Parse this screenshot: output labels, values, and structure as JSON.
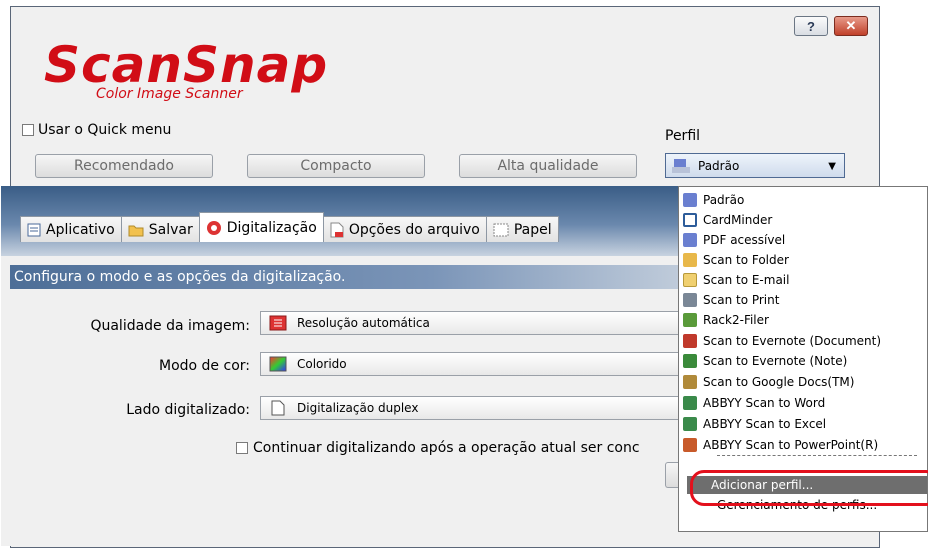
{
  "window": {
    "help_glyph": "?",
    "close_glyph": "✕"
  },
  "logo": {
    "brand": "ScanSnap",
    "tagline": "Color Image Scanner"
  },
  "quick_menu": {
    "label": "Usar o Quick menu",
    "checked": false
  },
  "profile": {
    "label": "Perfil",
    "selected": "Padrão"
  },
  "preset_buttons": [
    "Recomendado",
    "Compacto",
    "Alta qualidade"
  ],
  "tabs": [
    {
      "label": "Aplicativo",
      "icon": "application-icon"
    },
    {
      "label": "Salvar",
      "icon": "folder-icon"
    },
    {
      "label": "Digitalização",
      "icon": "scan-icon",
      "active": true
    },
    {
      "label": "Opções do arquivo",
      "icon": "file-options-icon"
    },
    {
      "label": "Papel",
      "icon": "paper-icon"
    }
  ],
  "scan_panel": {
    "description": "Configura o modo e as opções da digitalização.",
    "image_quality": {
      "label": "Qualidade da imagem:",
      "value": "Resolução automática"
    },
    "color_mode": {
      "label": "Modo de cor:",
      "value": "Colorido"
    },
    "scan_side": {
      "label": "Lado digitalizado:",
      "value": "Digitalização duplex"
    },
    "continue_scanning": {
      "label": "Continuar digitalizando após a operação atual ser conc",
      "checked": false
    }
  },
  "profile_dropdown": {
    "items": [
      {
        "label": "Padrão",
        "icon": "default-profile-icon",
        "color": "#6a7fd0"
      },
      {
        "label": "CardMinder",
        "icon": "card-icon",
        "color": "#2d5c9a"
      },
      {
        "label": "PDF acessível",
        "icon": "pdf-profile-icon",
        "color": "#6a7fd0"
      },
      {
        "label": "Scan to Folder",
        "icon": "folder-icon",
        "color": "#e8b84a"
      },
      {
        "label": "Scan to E-mail",
        "icon": "email-icon",
        "color": "#f0d070"
      },
      {
        "label": "Scan to Print",
        "icon": "printer-icon",
        "color": "#7a8796"
      },
      {
        "label": "Rack2-Filer",
        "icon": "rack2-icon",
        "color": "#5a9a3a"
      },
      {
        "label": "Scan to Evernote (Document)",
        "icon": "evernote-pdf-icon",
        "color": "#c0392b"
      },
      {
        "label": "Scan to Evernote (Note)",
        "icon": "evernote-jpg-icon",
        "color": "#3a8a3a"
      },
      {
        "label": "Scan to Google Docs(TM)",
        "icon": "google-docs-icon",
        "color": "#b08a3a"
      },
      {
        "label": "ABBYY Scan to Word",
        "icon": "abbyy-word-icon",
        "color": "#3a8a4a"
      },
      {
        "label": "ABBYY Scan to Excel",
        "icon": "abbyy-excel-icon",
        "color": "#3a8a4a"
      },
      {
        "label": "ABBYY Scan to PowerPoint(R)",
        "icon": "abbyy-powerpoint-icon",
        "color": "#c85a2a"
      }
    ],
    "add_profile": "Adicionar perfil...",
    "manage_profiles": "Gerenciamento de perfis..."
  },
  "colors": {
    "brand_red": "#d10d16",
    "highlight": "#e3101c",
    "description_bar": "#4d6e97"
  }
}
